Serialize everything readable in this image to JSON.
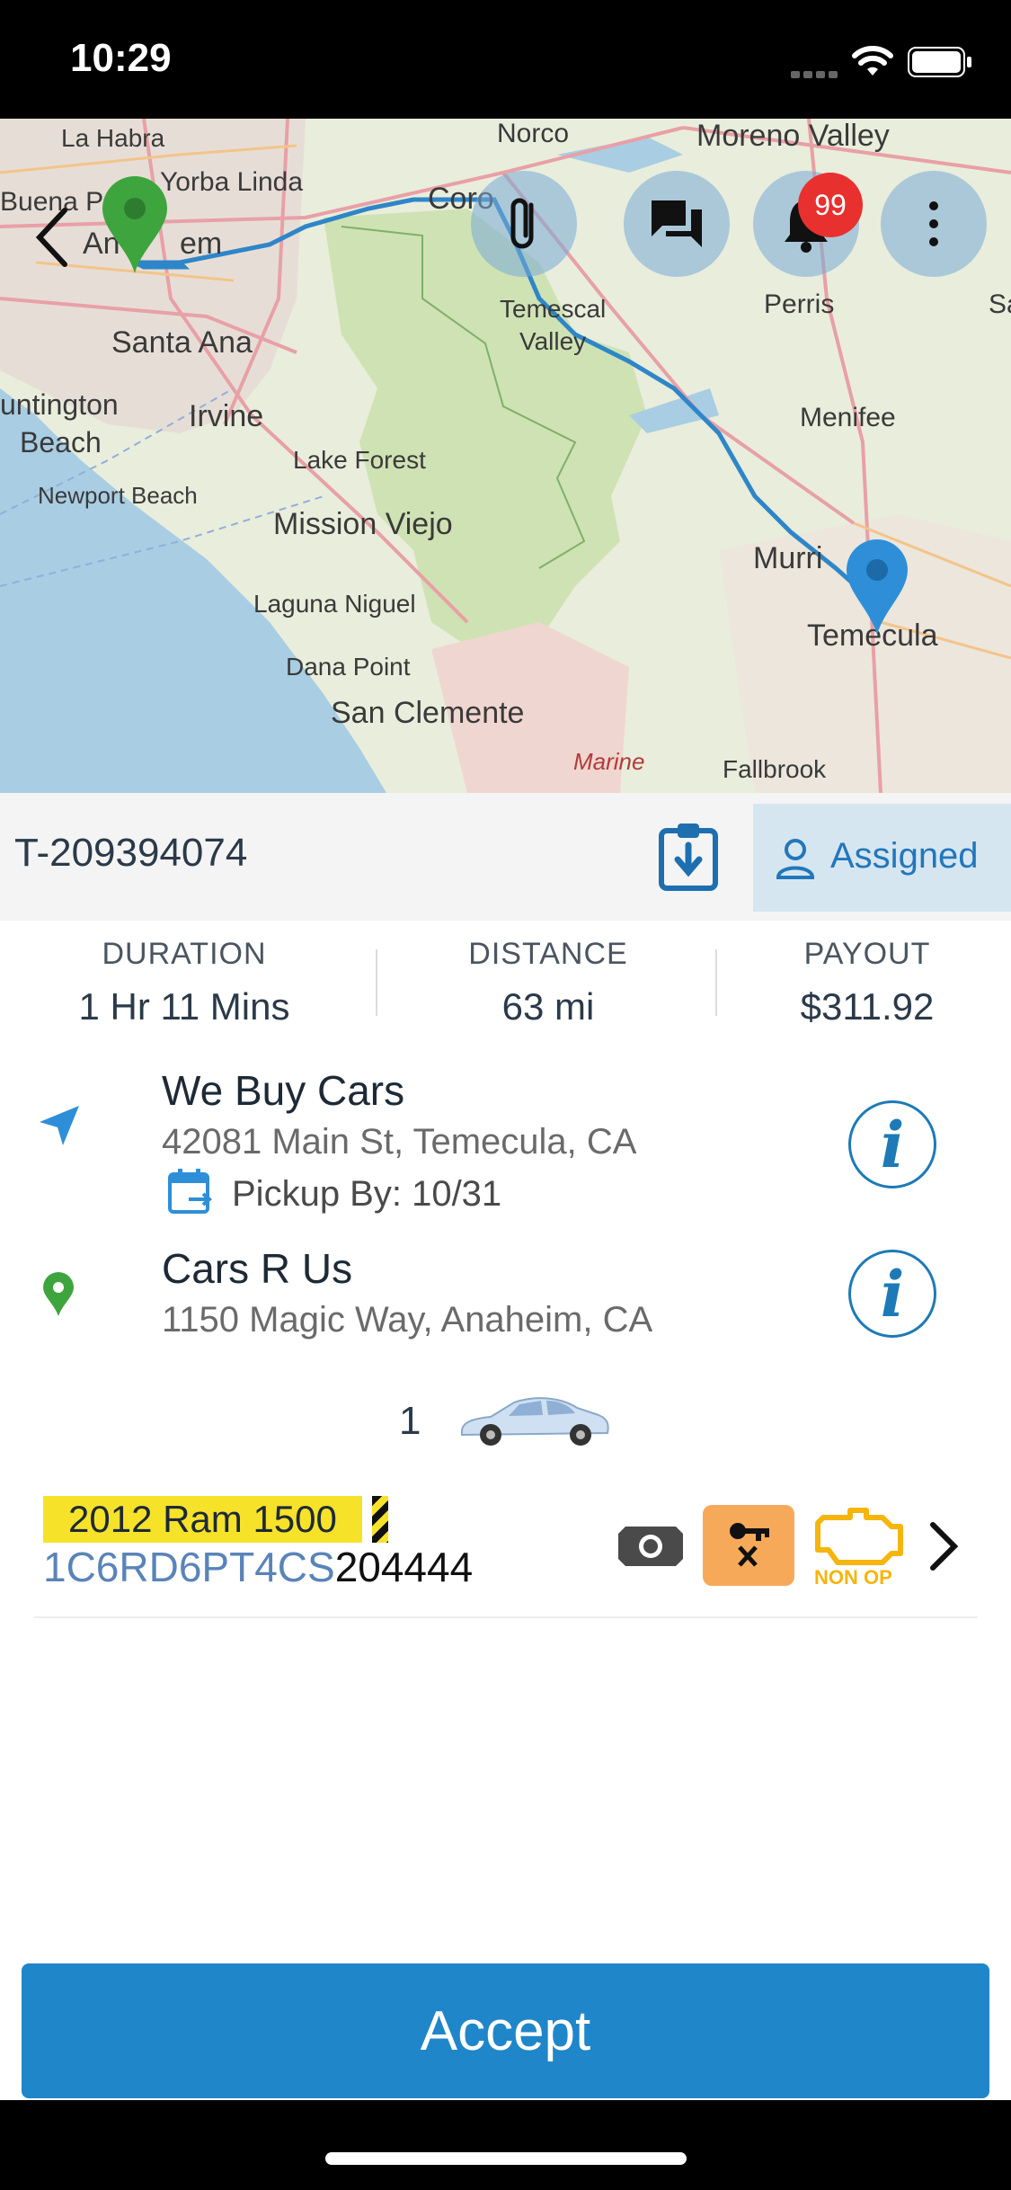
{
  "status_bar": {
    "time": "10:29"
  },
  "map": {
    "labels": {
      "la_habra": "La Habra",
      "norco": "Norco",
      "moreno_valley": "Moreno Valley",
      "yorba_linda": "Yorba Linda",
      "buena_park": "Buena P",
      "anaheim_left": "An",
      "anaheim_right": "em",
      "corona": "Coro",
      "santa_ana": "Santa Ana",
      "temescal": "Temescal",
      "valley": "Valley",
      "perris": "Perris",
      "huntington": "untington",
      "beach": "Beach",
      "irvine": "Irvine",
      "menifee": "Menifee",
      "lake_forest": "Lake Forest",
      "newport_beach": "Newport Beach",
      "mission_viejo": "Mission Viejo",
      "murrieta": "Murri",
      "laguna_niguel": "Laguna Niguel",
      "temecula": "Temecula",
      "dana_point": "Dana Point",
      "san_clemente": "San Clemente",
      "marine": "Marine",
      "fallbrook": "Fallbrook",
      "sa": "Sa"
    },
    "notification_count": "99"
  },
  "order": {
    "id": "T-209394074",
    "status": "Assigned"
  },
  "stats": {
    "duration_label": "DURATION",
    "duration_value": "1 Hr 11 Mins",
    "distance_label": "DISTANCE",
    "distance_value": "63 mi",
    "payout_label": "PAYOUT",
    "payout_value": "$311.92"
  },
  "pickup": {
    "name": "We Buy Cars",
    "address": "42081 Main St, Temecula, CA",
    "pickup_by": "Pickup By: 10/31"
  },
  "dropoff": {
    "name": "Cars R Us",
    "address": "1150 Magic Way, Anaheim, CA"
  },
  "vehicles": {
    "count": "1",
    "items": [
      {
        "title": "2012 Ram 1500",
        "vin_prefix": "1C6RD6PT4CS",
        "vin_suffix": "204444",
        "non_op_label": "NON OP"
      }
    ]
  },
  "actions": {
    "accept_label": "Accept"
  },
  "colors": {
    "primary": "#1f86c9",
    "highlight": "#f7e22a",
    "warning": "#f7a95a",
    "non_op": "#f5b50c",
    "badge": "#e8302f"
  }
}
